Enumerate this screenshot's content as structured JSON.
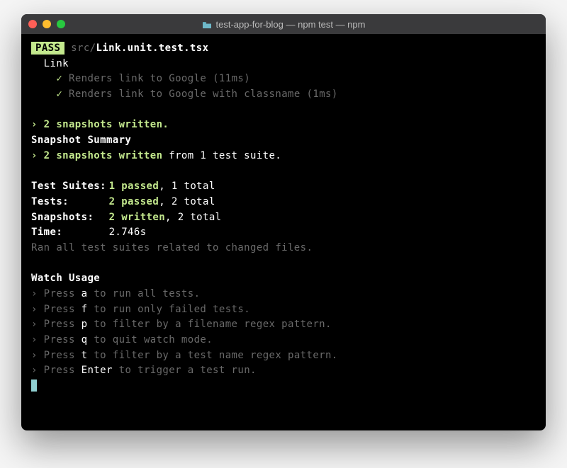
{
  "window": {
    "title": "test-app-for-blog — npm test — npm",
    "folder_icon": "folder-icon"
  },
  "pass": {
    "label": "PASS"
  },
  "file": {
    "dir": "src/",
    "name": "Link.unit.test.tsx"
  },
  "describe": "Link",
  "tests_list": [
    {
      "name": "Renders link to Google",
      "time": "(11ms)"
    },
    {
      "name": "Renders link to Google with classname",
      "time": "(1ms)"
    }
  ],
  "snapshots_written_line": " › 2 snapshots written.",
  "snapshot_summary_heading": "Snapshot Summary",
  "snapshot_summary_prefix": " › 2 snapshots written",
  "snapshot_summary_suffix": " from 1 test suite.",
  "suites": {
    "label": "Test Suites:",
    "passed": "1 passed",
    "rest": ", 1 total"
  },
  "tests": {
    "label": "Tests:",
    "passed": "2 passed",
    "rest": ", 2 total"
  },
  "snapshots": {
    "label": "Snapshots:",
    "written": "2 written",
    "rest": ", 2 total"
  },
  "time": {
    "label": "Time:",
    "value": "2.746s"
  },
  "ran_msg": "Ran all test suites related to changed files.",
  "watch": {
    "heading": "Watch Usage",
    "items": [
      {
        "key": "a",
        "desc": " to run all tests."
      },
      {
        "key": "f",
        "desc": " to run only failed tests."
      },
      {
        "key": "p",
        "desc": " to filter by a filename regex pattern."
      },
      {
        "key": "q",
        "desc": " to quit watch mode."
      },
      {
        "key": "t",
        "desc": " to filter by a test name regex pattern."
      },
      {
        "key": "Enter",
        "desc": " to trigger a test run."
      }
    ]
  }
}
